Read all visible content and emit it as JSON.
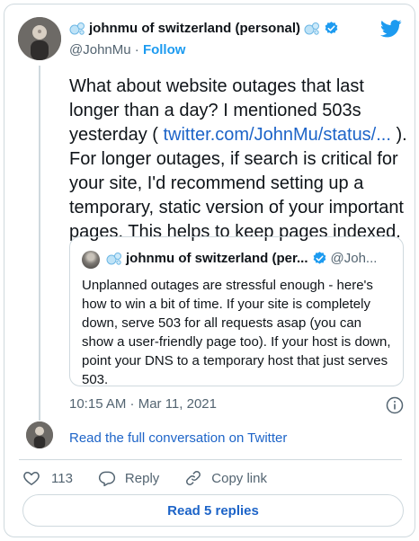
{
  "author": {
    "name": "johnmu of switzerland (personal)",
    "handle": "@JohnMu",
    "separator": "·",
    "follow_label": "Follow",
    "name_emoji_icon": "soap-bubbles-icon",
    "verified_icon": "verified-badge-icon"
  },
  "brand_icon": "twitter-bird-icon",
  "tweet": {
    "text_before_link": "What about website outages that last longer than a day? I mentioned 503s yesterday ( ",
    "link_text": "twitter.com/JohnMu/status/...",
    "text_after_link": " ). For longer outages, if search is critical for your site, I'd recommend setting up a temporary, static version of your important pages. This helps to keep pages indexed."
  },
  "quoted_tweet": {
    "name": "johnmu of switzerland (per...",
    "handle": "@Joh...",
    "text": "Unplanned outages are stressful enough - here's how to win a bit of time. If your site is completely down, serve 503 for all requests asap (you can show a user-friendly page too). If your host is down, point your DNS to a temporary host that just serves 503."
  },
  "timestamp": "10:15 AM · Mar 11, 2021",
  "read_full_conversation": "Read the full conversation on Twitter",
  "actions": {
    "likes_count": "113",
    "reply_label": "Reply",
    "copy_link_label": "Copy link"
  },
  "read_replies_label": "Read 5 replies",
  "colors": {
    "accent": "#1d9bf0",
    "link": "#1d64c8",
    "text": "#0f1419",
    "muted": "#536471",
    "border": "#cfd9de"
  }
}
